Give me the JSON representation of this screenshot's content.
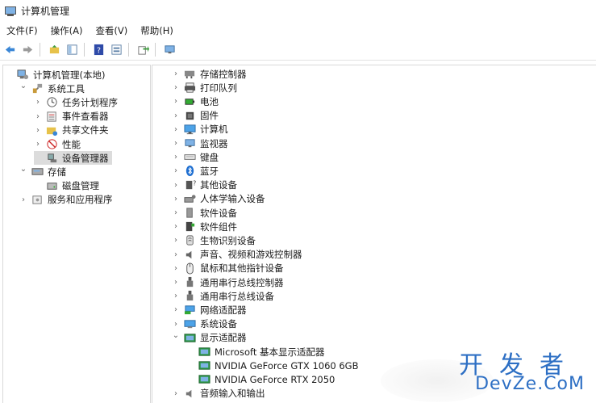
{
  "window": {
    "title": "计算机管理"
  },
  "menu": [
    "文件(F)",
    "操作(A)",
    "查看(V)",
    "帮助(H)"
  ],
  "toolbar": [
    "back-arrow-icon",
    "forward-arrow-icon",
    "up-folder-icon",
    "show-hide-tree-icon",
    "help-icon",
    "properties-icon",
    "export-icon",
    "monitor-icon"
  ],
  "left_tree": [
    {
      "label": "计算机管理(本地)",
      "icon": "computer-manage-icon",
      "level": 0,
      "chev": ""
    },
    {
      "label": "系统工具",
      "icon": "tools-icon",
      "level": 1,
      "chev": "open"
    },
    {
      "label": "任务计划程序",
      "icon": "clock-icon",
      "level": 2,
      "chev": "closed"
    },
    {
      "label": "事件查看器",
      "icon": "event-viewer-icon",
      "level": 2,
      "chev": "closed"
    },
    {
      "label": "共享文件夹",
      "icon": "shared-folder-icon",
      "level": 2,
      "chev": "closed"
    },
    {
      "label": "性能",
      "icon": "performance-icon",
      "level": 2,
      "chev": "closed"
    },
    {
      "label": "设备管理器",
      "icon": "device-manager-icon",
      "level": 2,
      "chev": "",
      "selected": true
    },
    {
      "label": "存储",
      "icon": "storage-icon",
      "level": 1,
      "chev": "open"
    },
    {
      "label": "磁盘管理",
      "icon": "disk-management-icon",
      "level": 2,
      "chev": ""
    },
    {
      "label": "服务和应用程序",
      "icon": "services-icon",
      "level": 1,
      "chev": "closed"
    }
  ],
  "devices": [
    {
      "label": "存储控制器",
      "icon": "storage-controller-icon",
      "level": 0,
      "chev": "closed"
    },
    {
      "label": "打印队列",
      "icon": "printer-icon",
      "level": 0,
      "chev": "closed"
    },
    {
      "label": "电池",
      "icon": "battery-icon",
      "level": 0,
      "chev": "closed"
    },
    {
      "label": "固件",
      "icon": "firmware-icon",
      "level": 0,
      "chev": "closed"
    },
    {
      "label": "计算机",
      "icon": "computer-icon",
      "level": 0,
      "chev": "closed"
    },
    {
      "label": "监视器",
      "icon": "monitor-icon",
      "level": 0,
      "chev": "closed"
    },
    {
      "label": "键盘",
      "icon": "keyboard-icon",
      "level": 0,
      "chev": "closed"
    },
    {
      "label": "蓝牙",
      "icon": "bluetooth-icon",
      "level": 0,
      "chev": "closed"
    },
    {
      "label": "其他设备",
      "icon": "other-devices-icon",
      "level": 0,
      "chev": "closed"
    },
    {
      "label": "人体学输入设备",
      "icon": "hid-icon",
      "level": 0,
      "chev": "closed"
    },
    {
      "label": "软件设备",
      "icon": "software-device-icon",
      "level": 0,
      "chev": "closed"
    },
    {
      "label": "软件组件",
      "icon": "software-component-icon",
      "level": 0,
      "chev": "closed"
    },
    {
      "label": "生物识别设备",
      "icon": "biometric-icon",
      "level": 0,
      "chev": "closed"
    },
    {
      "label": "声音、视频和游戏控制器",
      "icon": "speaker-icon",
      "level": 0,
      "chev": "closed"
    },
    {
      "label": "鼠标和其他指针设备",
      "icon": "mouse-icon",
      "level": 0,
      "chev": "closed"
    },
    {
      "label": "通用串行总线控制器",
      "icon": "usb-icon",
      "level": 0,
      "chev": "closed"
    },
    {
      "label": "通用串行总线设备",
      "icon": "usb-icon",
      "level": 0,
      "chev": "closed"
    },
    {
      "label": "网络适配器",
      "icon": "network-adapter-icon",
      "level": 0,
      "chev": "closed"
    },
    {
      "label": "系统设备",
      "icon": "system-device-icon",
      "level": 0,
      "chev": "closed"
    },
    {
      "label": "显示适配器",
      "icon": "display-adapter-icon",
      "level": 0,
      "chev": "open"
    },
    {
      "label": "Microsoft 基本显示适配器",
      "icon": "display-adapter-icon",
      "level": 1,
      "chev": ""
    },
    {
      "label": "NVIDIA GeForce GTX 1060 6GB",
      "icon": "display-adapter-icon",
      "level": 1,
      "chev": ""
    },
    {
      "label": "NVIDIA GeForce RTX 2050",
      "icon": "display-adapter-icon",
      "level": 1,
      "chev": ""
    },
    {
      "label": "音频输入和输出",
      "icon": "audio-io-icon",
      "level": 0,
      "chev": "closed"
    }
  ],
  "watermark": {
    "top": "开发者",
    "bottom": "DevZe.CoM"
  },
  "colors": {
    "accent": "#2d6fc4",
    "selection": "#dcdcdc",
    "border": "#d8d8d8"
  }
}
